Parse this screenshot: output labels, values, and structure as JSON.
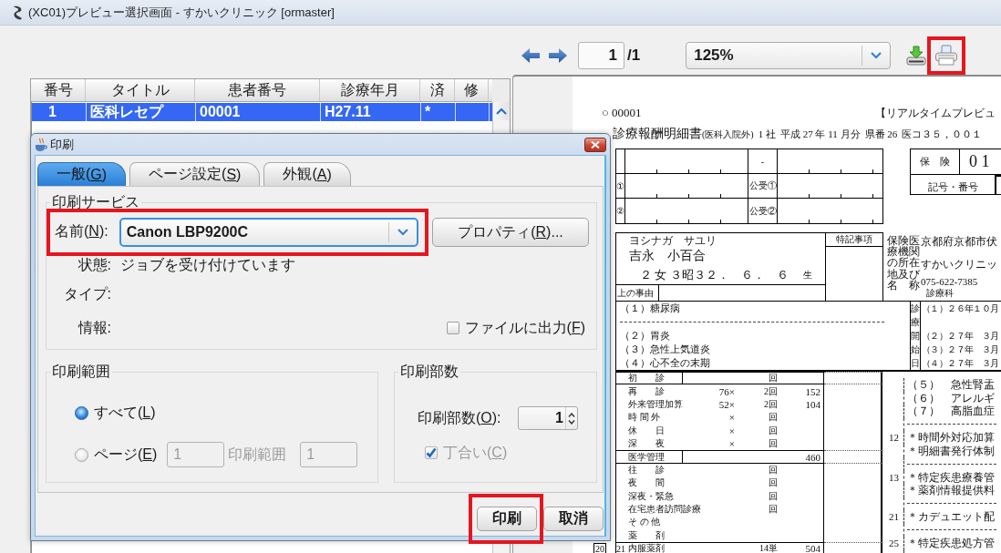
{
  "window": {
    "title": "(XC01)プレビュー選択画面 - すかいクリニック [ormaster]"
  },
  "list": {
    "columns": [
      "番号",
      "タイトル",
      "患者番号",
      "診療年月",
      "済",
      "修"
    ],
    "rows": [
      {
        "number": "1",
        "title": "医科レセプ",
        "patient_number": "00001",
        "month": "H27.11",
        "done": "*",
        "selected": true
      }
    ]
  },
  "toolbar": {
    "page": "1",
    "page_total": "/1",
    "zoom": "125%",
    "print_highlighted": true
  },
  "document": {
    "record": "○ 00001",
    "banner": "【リアルタイムプレビュ",
    "title": "診療報酬明細書",
    "title_note": "(医科入院外)",
    "title_fields": [
      "1 社",
      "平成 27 年 11 月分",
      "県番 26",
      "医コ３５，００１"
    ],
    "insurer_rows": [
      {
        "public_label": "-"
      },
      {
        "mark": "①",
        "public_label": "公受①"
      },
      {
        "mark": "②",
        "public_label": "公受②"
      }
    ],
    "insurance": {
      "label": "保　険",
      "number": "0 1",
      "id_label": "記号・番号"
    },
    "patient": {
      "kana": "ヨシナガ　サユリ",
      "name": "吉永　小百合",
      "details": "２ 女 ３昭３２．　６．　６",
      "born": "生",
      "reason_label": "上の事由",
      "notes_label": "特記事項"
    },
    "facility": {
      "label": "保険医療機関の所在地及び名　称",
      "address": "京都府京都市伏",
      "name": "すかいクリニッ",
      "phone": "075-622-7385",
      "department": "診療科"
    },
    "diseases": [
      {
        "kind": "entry",
        "text": "（１）糖尿病",
        "start": "（１）２６年１０月"
      },
      {
        "kind": "rule"
      },
      {
        "kind": "entry",
        "text": "（２）胃炎",
        "start": "（２）２７年　３月"
      },
      {
        "kind": "entry",
        "text": "（３）急性上気道炎",
        "start": "（３）２７年　３月"
      },
      {
        "kind": "entry",
        "text": "（４）心不全の末期",
        "start": "（４）２７年　３月"
      }
    ],
    "start_label": "診療開始日",
    "fees": [
      {
        "kind": "section",
        "label": "初　　診",
        "count": "回"
      },
      {
        "kind": "item",
        "label": "再　　診",
        "rate": "76×",
        "count": "2回",
        "points": "152"
      },
      {
        "kind": "item",
        "label": "外来管理加算",
        "rate": "52×",
        "count": "2回",
        "points": "104"
      },
      {
        "kind": "item",
        "label": "時 間 外",
        "rate": "×",
        "count": "回"
      },
      {
        "kind": "item",
        "label": "休　　日",
        "rate": "×",
        "count": "回"
      },
      {
        "kind": "item",
        "label": "深　　夜",
        "rate": "×",
        "count": "回"
      },
      {
        "kind": "section",
        "label": "医学管理",
        "points": "460"
      },
      {
        "kind": "item",
        "label": "往　　診",
        "count": "回"
      },
      {
        "kind": "item",
        "label": "夜　　間",
        "count": "回"
      },
      {
        "kind": "item",
        "label": "深夜・緊急",
        "count": "回"
      },
      {
        "kind": "item",
        "label": "在宅患者訪問診療",
        "count": "回"
      },
      {
        "kind": "item",
        "label": "そ の 他"
      },
      {
        "kind": "item",
        "label": "薬　　剤"
      },
      {
        "kind": "drug",
        "code": "20",
        "sub_code": "21",
        "label": "内服薬剤",
        "count": "14単",
        "points": "504"
      }
    ],
    "details": [
      {
        "lines": [
          "（５）　急性腎盂",
          "（６）　アレルギ",
          "（７）　高脂血症"
        ]
      },
      {
        "code": "12",
        "lines": [
          "＊時間外対応加算",
          "＊明細書発行体制"
        ]
      },
      {
        "code": "13",
        "lines": [
          "＊特定疾患療養管",
          "＊薬剤情報提供料"
        ]
      },
      {
        "code": "21",
        "lines": [
          "＊カデュエット配"
        ]
      },
      {
        "code": "25",
        "lines": [
          "＊特定疾患処方管"
        ]
      }
    ]
  },
  "dialog": {
    "title": "印刷",
    "tabs": [
      {
        "label": "一般(",
        "mnemonic": "G",
        "suffix": ")",
        "selected": true
      },
      {
        "label": "ページ設定(",
        "mnemonic": "S",
        "suffix": ")",
        "selected": false
      },
      {
        "label": "外観(",
        "mnemonic": "A",
        "suffix": ")",
        "selected": false
      }
    ],
    "service": {
      "title": "印刷サービス",
      "name_label": "名前(",
      "name_mnemonic": "N",
      "name_suffix": "):",
      "printer": "Canon LBP9200C",
      "highlighted": true,
      "properties": "プロパティ(",
      "properties_mnemonic": "R",
      "properties_suffix": ")...",
      "status_label": "状態:",
      "status": "ジョブを受け付けています",
      "type_label": "タイプ:",
      "info_label": "情報:",
      "file_output": {
        "label": "ファイルに出力(",
        "mnemonic": "F",
        "suffix": ")",
        "checked": false
      }
    },
    "range": {
      "title": "印刷範囲",
      "options": [
        {
          "label": "すべて(",
          "mnemonic": "L",
          "suffix": ")",
          "selected": true
        },
        {
          "label": "ページ(",
          "mnemonic": "E",
          "suffix": ")",
          "selected": false
        }
      ],
      "from": "1",
      "to_label": "印刷範囲",
      "to": "1",
      "disabled": true
    },
    "copies": {
      "title": "印刷部数",
      "label": "印刷部数(",
      "mnemonic": "O",
      "suffix": "):",
      "value": "1",
      "collate": {
        "label": "丁合い(",
        "mnemonic": "C",
        "suffix": ")",
        "checked": true,
        "disabled": true
      }
    },
    "buttons": [
      {
        "label": "印刷",
        "highlighted": true
      },
      {
        "label": "取消",
        "highlighted": false
      }
    ]
  }
}
